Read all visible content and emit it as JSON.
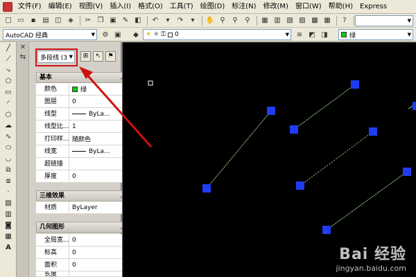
{
  "menubar": {
    "items": [
      "文件(F)",
      "编辑(E)",
      "视图(V)",
      "插入(I)",
      "格式(O)",
      "工具(T)",
      "绘图(D)",
      "标注(N)",
      "修改(M)",
      "窗口(W)",
      "帮助(H)",
      "Express"
    ]
  },
  "toolbar2": {
    "workspace": "AutoCAD 经典",
    "layer": "0",
    "color": "绿"
  },
  "properties": {
    "selection": "多段线 (3",
    "sections": {
      "basic": "基本",
      "three_d": "三维效果",
      "geometry": "几何图形"
    },
    "basic_rows": [
      {
        "key": "颜色",
        "value": "绿"
      },
      {
        "key": "图层",
        "value": "0"
      },
      {
        "key": "线型",
        "value": "ByLa..."
      },
      {
        "key": "线型比...",
        "value": "1"
      },
      {
        "key": "打印样...",
        "value": "随颜色"
      },
      {
        "key": "线宽",
        "value": "ByLa..."
      },
      {
        "key": "超链接",
        "value": ""
      },
      {
        "key": "厚度",
        "value": "0"
      }
    ],
    "three_d_rows": [
      {
        "key": "材质",
        "value": "ByLayer"
      }
    ],
    "geometry_rows": [
      {
        "key": "全局宽...",
        "value": "0"
      },
      {
        "key": "标高",
        "value": "0"
      },
      {
        "key": "面积",
        "value": "0"
      },
      {
        "key": "长度",
        "value": ""
      }
    ]
  },
  "watermark": {
    "brand": "Bai 经验",
    "site": "jingyan.baidu.com"
  },
  "colors": {
    "canvas": "#000000",
    "polyline": "#9ad48a",
    "grip": "#1f3df0",
    "annotation": "#d01010",
    "swatch_green": "#14c814"
  }
}
